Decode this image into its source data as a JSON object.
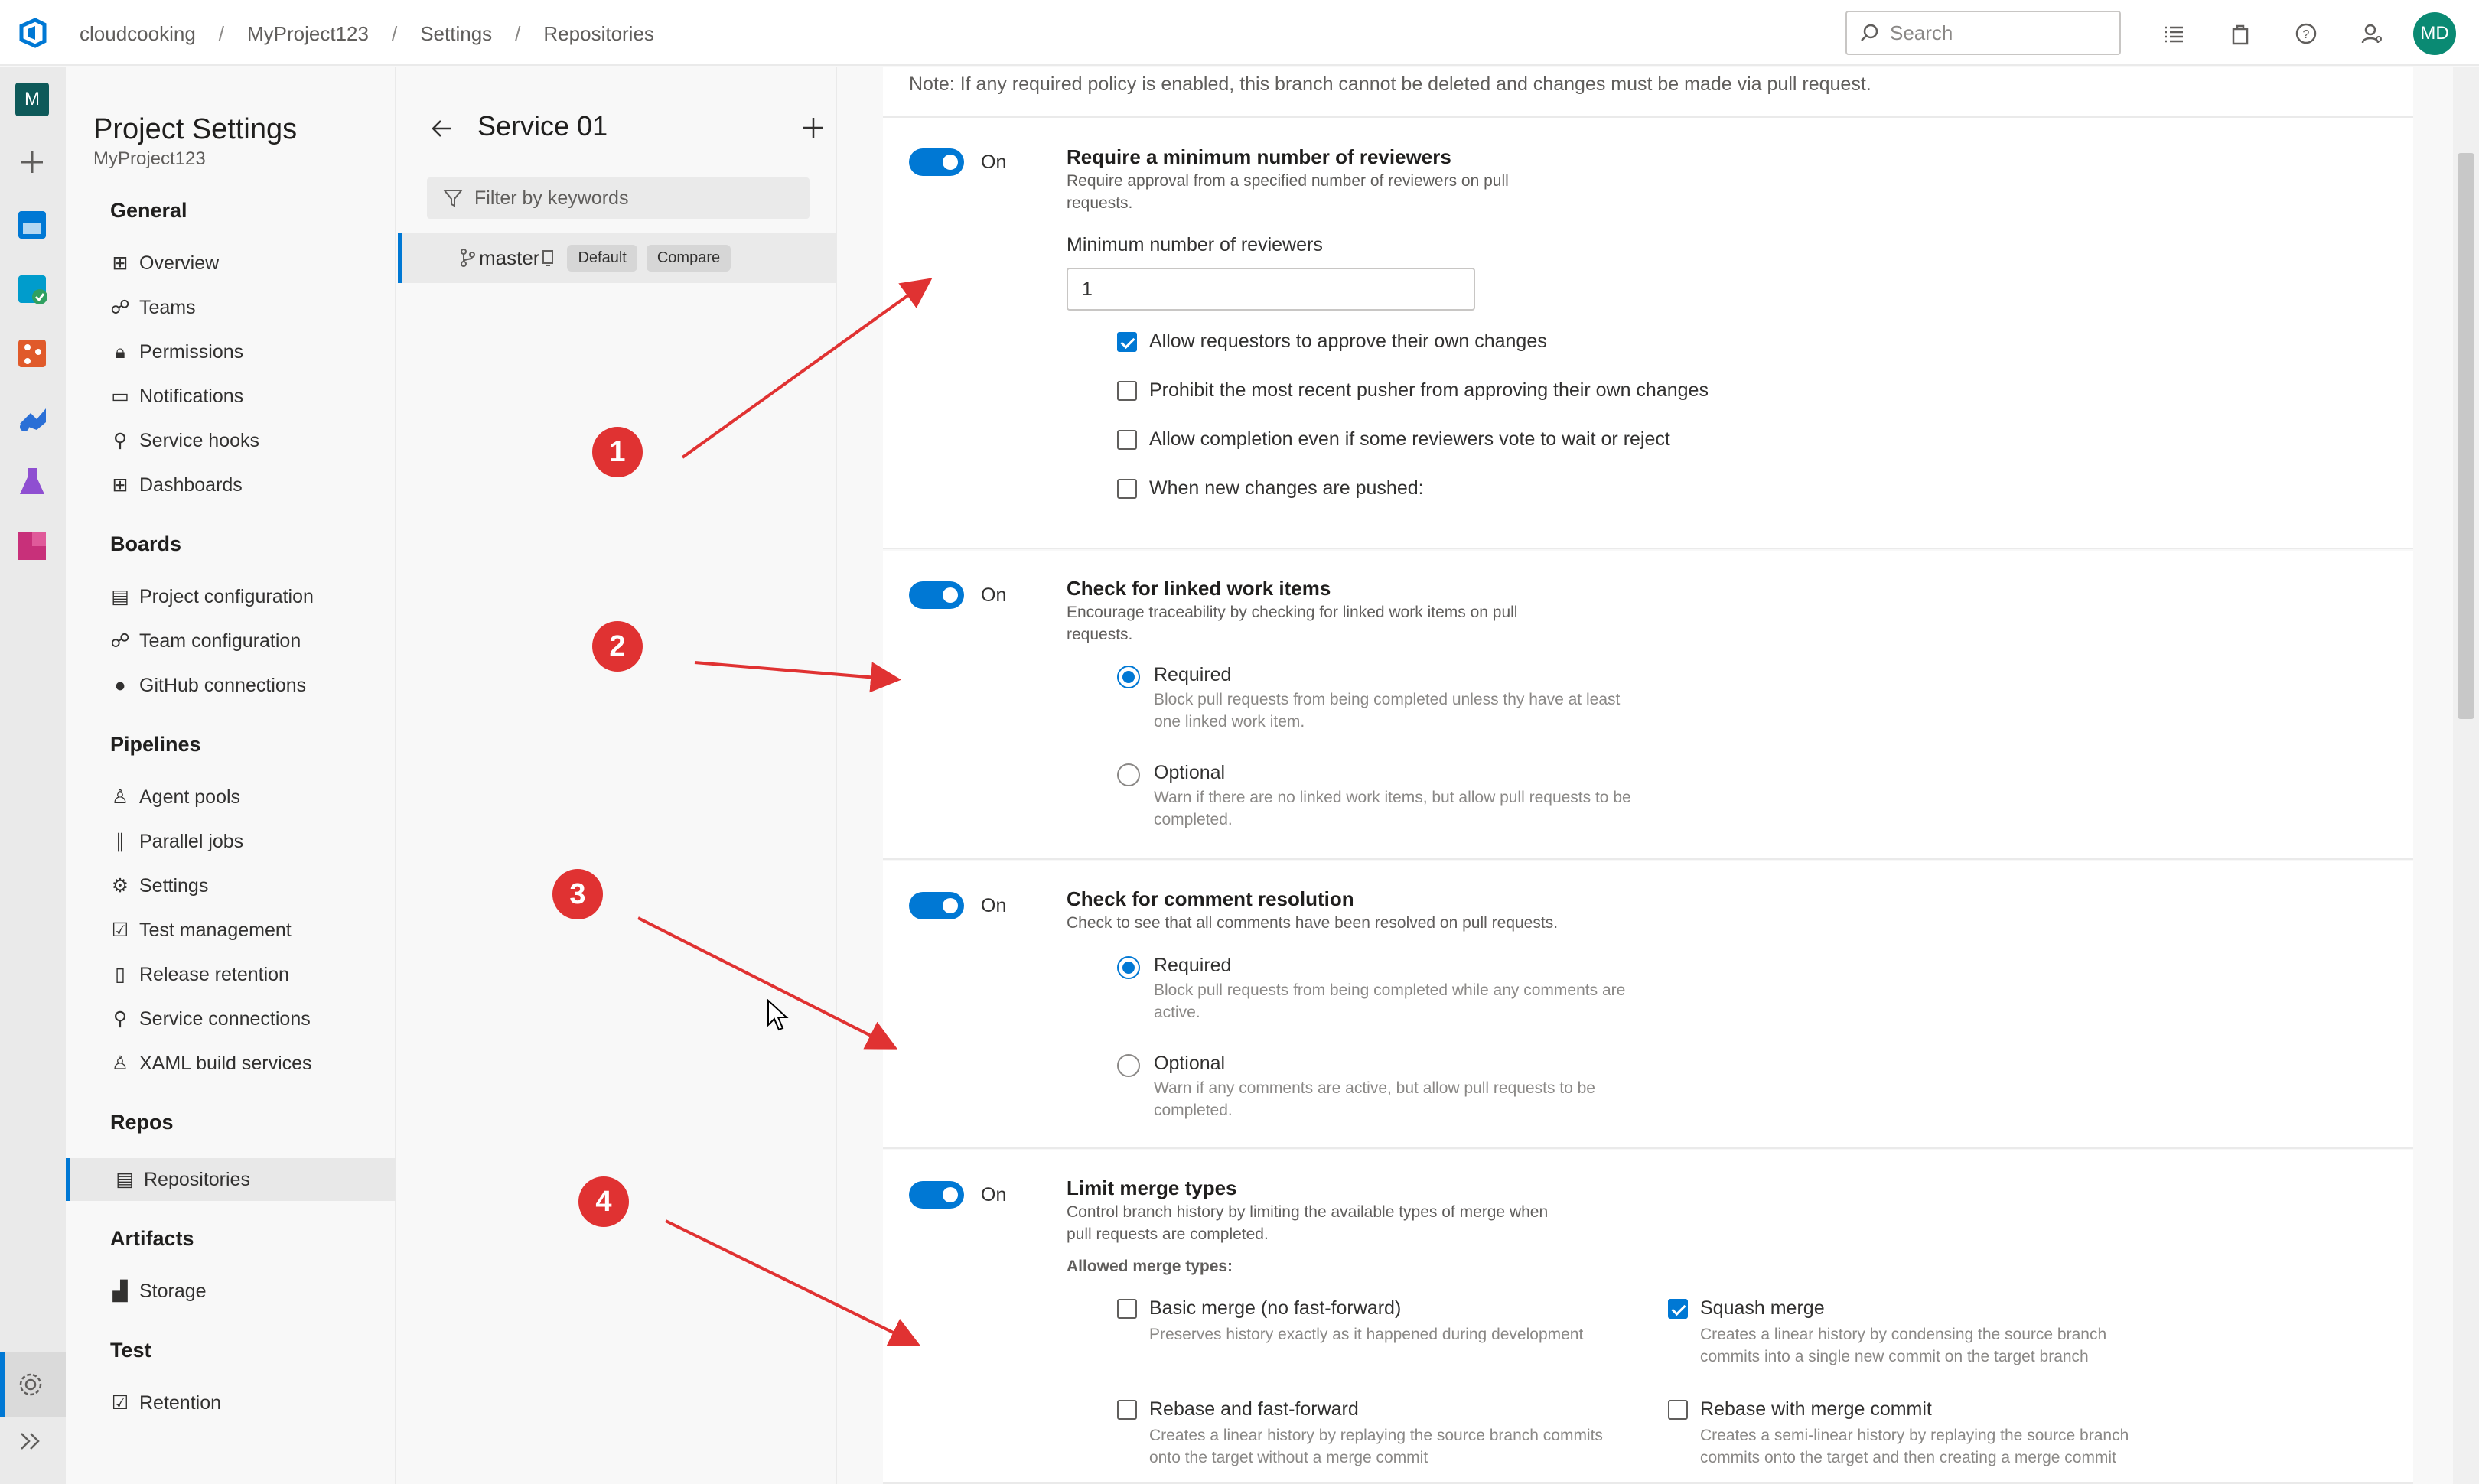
{
  "breadcrumb": [
    "cloudcooking",
    "MyProject123",
    "Settings",
    "Repositories"
  ],
  "search": {
    "placeholder": "Search"
  },
  "user": {
    "initials": "MD"
  },
  "rail": {
    "org_initial": "M"
  },
  "settings_nav": {
    "title": "Project Settings",
    "subtitle": "MyProject123",
    "sections": [
      {
        "label": "General",
        "items": [
          "Overview",
          "Teams",
          "Permissions",
          "Notifications",
          "Service hooks",
          "Dashboards"
        ]
      },
      {
        "label": "Boards",
        "items": [
          "Project configuration",
          "Team configuration",
          "GitHub connections"
        ]
      },
      {
        "label": "Pipelines",
        "items": [
          "Agent pools",
          "Parallel jobs",
          "Settings",
          "Test management",
          "Release retention",
          "Service connections",
          "XAML build services"
        ]
      },
      {
        "label": "Repos",
        "items": [
          "Repositories"
        ]
      },
      {
        "label": "Artifacts",
        "items": [
          "Storage"
        ]
      },
      {
        "label": "Test",
        "items": [
          "Retention"
        ]
      }
    ],
    "selected": "Repositories"
  },
  "branch_panel": {
    "title": "Service 01",
    "filter_placeholder": "Filter by keywords",
    "branch": {
      "name": "master",
      "default_label": "Default",
      "compare_label": "Compare"
    }
  },
  "policies": {
    "note": "Note: If any required policy is enabled, this branch cannot be deleted and changes must be made via pull request.",
    "toggle_label": "On",
    "reviewers": {
      "title": "Require a minimum number of reviewers",
      "description": "Require approval from a specified number of reviewers on pull requests.",
      "min_label": "Minimum number of reviewers",
      "min_value": "1",
      "options": [
        {
          "label": "Allow requestors to approve their own changes",
          "checked": true
        },
        {
          "label": "Prohibit the most recent pusher from approving their own changes",
          "checked": false
        },
        {
          "label": "Allow completion even if some reviewers vote to wait or reject",
          "checked": false
        },
        {
          "label": "When new changes are pushed:",
          "checked": false
        }
      ]
    },
    "work_items": {
      "title": "Check for linked work items",
      "description": "Encourage traceability by checking for linked work items on pull requests.",
      "required_label": "Required",
      "required_desc": "Block pull requests from being completed unless thy have at least one linked work item.",
      "optional_label": "Optional",
      "optional_desc": "Warn if there are no linked work items, but allow pull requests to be completed.",
      "selected": "Required"
    },
    "comments": {
      "title": "Check for comment resolution",
      "description": "Check to see that all comments have been resolved on pull requests.",
      "required_label": "Required",
      "required_desc": "Block pull requests from being completed while any comments are active.",
      "optional_label": "Optional",
      "optional_desc": "Warn if any comments are active, but allow pull requests to be completed.",
      "selected": "Required"
    },
    "merge_types": {
      "title": "Limit merge types",
      "description": "Control branch history by limiting the available types of merge when pull requests are completed.",
      "allowed_label": "Allowed merge types:",
      "types": [
        {
          "label": "Basic merge (no fast-forward)",
          "desc": "Preserves history exactly as it happened during development",
          "checked": false
        },
        {
          "label": "Squash merge",
          "desc": "Creates a linear history by condensing the source branch commits into a single new commit on the target branch",
          "checked": true
        },
        {
          "label": "Rebase and fast-forward",
          "desc": "Creates a linear history by replaying the source branch commits onto the target without a merge commit",
          "checked": false
        },
        {
          "label": "Rebase with merge commit",
          "desc": "Creates a semi-linear history by replaying the source branch commits onto the target and then creating a merge commit",
          "checked": false
        }
      ]
    }
  },
  "annotations": [
    "1",
    "2",
    "3",
    "4"
  ],
  "colors": {
    "accent": "#0078d4",
    "annotation": "#e03232",
    "avatar": "#0a8a73"
  }
}
